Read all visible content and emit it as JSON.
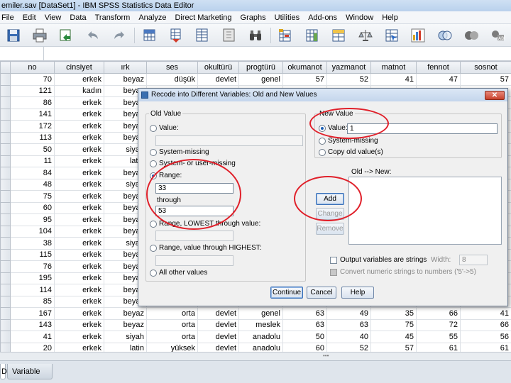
{
  "window": {
    "title": "emiler.sav [DataSet1] - IBM SPSS Statistics Data Editor"
  },
  "menu": [
    "File",
    "Edit",
    "View",
    "Data",
    "Transform",
    "Analyze",
    "Direct Marketing",
    "Graphs",
    "Utilities",
    "Add-ons",
    "Window",
    "Help"
  ],
  "toolbar": {
    "icons": [
      "save-icon",
      "print-icon",
      "dialog-recall-icon",
      "undo-icon",
      "redo-icon",
      "goto-case-icon",
      "goto-variable-icon",
      "variables-icon",
      "find-icon",
      "insert-cases-icon",
      "insert-variable-icon",
      "split-file-icon",
      "weight-cases-icon",
      "select-cases-icon",
      "value-labels-icon",
      "use-sets-icon",
      "show-all-variables-icon",
      "spelling-icon"
    ]
  },
  "grid": {
    "columns": [
      "no",
      "cinsiyet",
      "ırk",
      "ses",
      "okultürü",
      "progtürü",
      "okumanot",
      "yazmanot",
      "matnot",
      "fennot",
      "sosnot"
    ],
    "rows": [
      [
        "70",
        "erkek",
        "beyaz",
        "düşük",
        "devlet",
        "genel",
        "57",
        "52",
        "41",
        "47",
        "57"
      ],
      [
        "121",
        "kadın",
        "beyaz",
        "",
        "",
        "",
        "",
        "",
        "",
        "",
        ""
      ],
      [
        "86",
        "erkek",
        "beyaz",
        "",
        "",
        "",
        "",
        "",
        "",
        "",
        ""
      ],
      [
        "141",
        "erkek",
        "beyaz",
        "",
        "",
        "",
        "",
        "",
        "",
        "",
        ""
      ],
      [
        "172",
        "erkek",
        "beyaz",
        "",
        "",
        "",
        "",
        "",
        "",
        "",
        ""
      ],
      [
        "113",
        "erkek",
        "beyaz",
        "",
        "",
        "",
        "",
        "",
        "",
        "",
        ""
      ],
      [
        "50",
        "erkek",
        "siyah",
        "",
        "",
        "",
        "",
        "",
        "",
        "",
        ""
      ],
      [
        "11",
        "erkek",
        "latin",
        "",
        "",
        "",
        "",
        "",
        "",
        "",
        ""
      ],
      [
        "84",
        "erkek",
        "beyaz",
        "",
        "",
        "",
        "",
        "",
        "",
        "",
        ""
      ],
      [
        "48",
        "erkek",
        "siyah",
        "",
        "",
        "",
        "",
        "",
        "",
        "",
        ""
      ],
      [
        "75",
        "erkek",
        "beyaz",
        "",
        "",
        "",
        "",
        "",
        "",
        "",
        ""
      ],
      [
        "60",
        "erkek",
        "beyaz",
        "",
        "",
        "",
        "",
        "",
        "",
        "",
        ""
      ],
      [
        "95",
        "erkek",
        "beyaz",
        "",
        "",
        "",
        "",
        "",
        "",
        "",
        ""
      ],
      [
        "104",
        "erkek",
        "beyaz",
        "",
        "",
        "",
        "",
        "",
        "",
        "",
        ""
      ],
      [
        "38",
        "erkek",
        "siyah",
        "",
        "",
        "",
        "",
        "",
        "",
        "",
        ""
      ],
      [
        "115",
        "erkek",
        "beyaz",
        "",
        "",
        "",
        "",
        "",
        "",
        "",
        ""
      ],
      [
        "76",
        "erkek",
        "beyaz",
        "",
        "",
        "",
        "",
        "",
        "",
        "",
        ""
      ],
      [
        "195",
        "erkek",
        "beyaz",
        "",
        "",
        "",
        "",
        "",
        "",
        "",
        ""
      ],
      [
        "114",
        "erkek",
        "beyaz",
        "",
        "",
        "",
        "",
        "",
        "",
        "",
        ""
      ],
      [
        "85",
        "erkek",
        "beyaz",
        "",
        "",
        "",
        "",
        "",
        "",
        "",
        ""
      ],
      [
        "167",
        "erkek",
        "beyaz",
        "orta",
        "devlet",
        "genel",
        "63",
        "49",
        "35",
        "66",
        "41"
      ],
      [
        "143",
        "erkek",
        "beyaz",
        "orta",
        "devlet",
        "meslek",
        "63",
        "63",
        "75",
        "72",
        "66"
      ],
      [
        "41",
        "erkek",
        "siyah",
        "orta",
        "devlet",
        "anadolu",
        "50",
        "40",
        "45",
        "55",
        "56"
      ],
      [
        "20",
        "erkek",
        "latin",
        "yüksek",
        "devlet",
        "anadolu",
        "60",
        "52",
        "57",
        "61",
        "61"
      ]
    ]
  },
  "tabs": {
    "data_view": "D",
    "variable_view": "Variable View"
  },
  "dialog": {
    "title": "Recode into Different Variables: Old and New Values",
    "old_value": {
      "legend": "Old Value",
      "value_label": "Value:",
      "system_missing": "System-missing",
      "system_or_user_missing": "System- or user-missing",
      "range_label": "Range:",
      "range_from": "33",
      "through_label": "through",
      "range_to": "53",
      "range_lowest": "Range, LOWEST through value:",
      "range_highest": "Range, value through HIGHEST:",
      "all_other": "All other values"
    },
    "new_value": {
      "legend": "New Value",
      "value_label": "Value:",
      "value": "1",
      "system_missing": "System-missing",
      "copy_old": "Copy old value(s)"
    },
    "old_new_label": "Old --> New:",
    "buttons": {
      "add": "Add",
      "change": "Change",
      "remove": "Remove",
      "continue": "Continue",
      "cancel": "Cancel",
      "help": "Help"
    },
    "output_strings": "Output variables are strings",
    "width_label": "Width:",
    "width_value": "8",
    "convert_numeric": "Convert numeric strings to numbers ('5'->5)"
  },
  "colors": {
    "annotation": "#e0202a",
    "accent": "#1c5fb5"
  }
}
